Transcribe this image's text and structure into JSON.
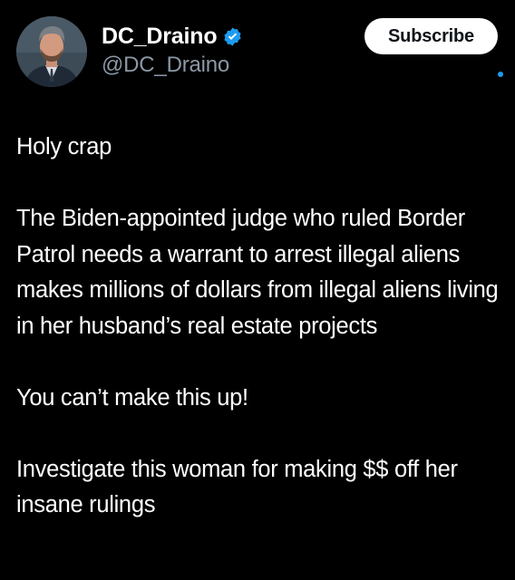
{
  "author": {
    "display_name": "DC_Draino",
    "handle": "@DC_Draino",
    "verified": true,
    "verified_color": "#1d9bf0"
  },
  "actions": {
    "subscribe_label": "Subscribe"
  },
  "tweet": {
    "paragraphs": [
      "Holy crap",
      "The Biden-appointed judge who ruled Border Patrol needs a warrant to arrest illegal aliens makes millions of dollars from illegal aliens living in her husband’s real estate projects",
      "You can’t make this up!",
      "Investigate this woman for making $$ off her insane rulings"
    ]
  },
  "icons": {
    "avatar": "user-avatar-photo",
    "verified": "verified-badge-icon"
  },
  "colors": {
    "background": "#000000",
    "text": "#ffffff",
    "secondary_text": "#8b98a5",
    "accent": "#1d9bf0"
  }
}
